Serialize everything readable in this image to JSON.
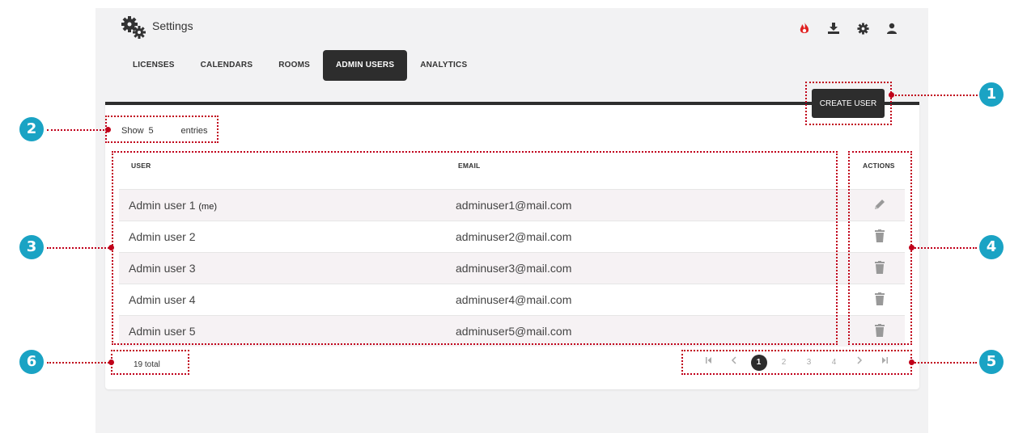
{
  "app": {
    "title": "Settings"
  },
  "top_icons": [
    {
      "name": "flame-icon",
      "color": "#e02020"
    },
    {
      "name": "download-icon",
      "color": "#333333"
    },
    {
      "name": "gear-icon",
      "color": "#333333"
    },
    {
      "name": "user-icon",
      "color": "#333333"
    }
  ],
  "tabs": [
    {
      "label": "LICENSES"
    },
    {
      "label": "CALENDARS"
    },
    {
      "label": "ROOMS"
    },
    {
      "label": "ADMIN USERS",
      "active": true
    },
    {
      "label": "ANALYTICS"
    }
  ],
  "toolbar": {
    "create_label": "CREATE USER"
  },
  "entries": {
    "prefix": "Show",
    "value": "5",
    "suffix": "entries"
  },
  "table": {
    "headers": {
      "user": "USER",
      "email": "EMAIL",
      "actions": "ACTIONS"
    },
    "rows": [
      {
        "user": "Admin user 1",
        "me": "(me)",
        "email": "adminuser1@mail.com",
        "action": "edit-icon"
      },
      {
        "user": "Admin user 2",
        "me": "",
        "email": "adminuser2@mail.com",
        "action": "trash-icon"
      },
      {
        "user": "Admin user 3",
        "me": "",
        "email": "adminuser3@mail.com",
        "action": "trash-icon"
      },
      {
        "user": "Admin user 4",
        "me": "",
        "email": "adminuser4@mail.com",
        "action": "trash-icon"
      },
      {
        "user": "Admin user 5",
        "me": "",
        "email": "adminuser5@mail.com",
        "action": "trash-icon"
      }
    ]
  },
  "footer": {
    "total": "19 total"
  },
  "pagination": {
    "pages": [
      "1",
      "2",
      "3",
      "4"
    ],
    "current": "1"
  },
  "callouts": [
    "1",
    "2",
    "3",
    "4",
    "5",
    "6"
  ],
  "colors": {
    "accent_dark": "#2d2d2d",
    "annotation_red": "#c0001a",
    "callout_blue": "#1aa3c4",
    "row_shade": "#f6f2f4"
  }
}
